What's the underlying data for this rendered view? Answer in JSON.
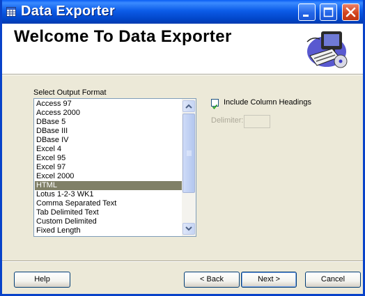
{
  "window": {
    "title": "Data Exporter",
    "header_title": "Welcome To Data Exporter"
  },
  "output_format": {
    "label": "Select Output Format",
    "items": [
      "Access 97",
      "Access 2000",
      "DBase 5",
      "DBase III",
      "DBase IV",
      "Excel 4",
      "Excel 95",
      "Excel 97",
      "Excel 2000",
      "HTML",
      "Lotus 1-2-3 WK1",
      "Comma Separated Text",
      "Tab Delimited Text",
      "Custom Delimited",
      "Fixed Length"
    ],
    "selected": "HTML"
  },
  "options": {
    "include_headings_label": "Include Column Headings",
    "include_headings_checked": true,
    "delimiter_label": "Delimiter:",
    "delimiter_value": ""
  },
  "buttons": {
    "help": "Help",
    "back": "< Back",
    "next": "Next >",
    "cancel": "Cancel"
  },
  "colors": {
    "title_bar": "#0a5ef5",
    "selection": "#808067",
    "dialog_bg": "#ece9d8"
  }
}
